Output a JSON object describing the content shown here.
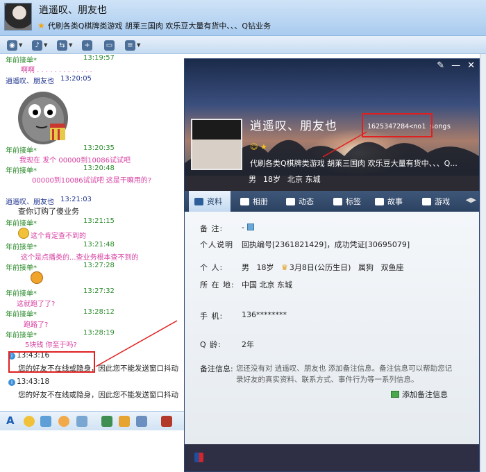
{
  "header": {
    "contact_name": "逍遥叹、朋友也",
    "signature": "代刷各类Q棋牌类游戏   胡莱三国肉   欢乐豆大量有货中、、、Q钻业务"
  },
  "chat": {
    "messages": [
      {
        "sender": "年前接单*",
        "time": "13:19:57",
        "text": "啊啊 . . . . . . . . . . . . ."
      },
      {
        "sender": "逍遥叹、朋友也",
        "time": "13:20:05"
      },
      {
        "sender": "年前接单*",
        "time": "13:20:35",
        "text": "我现在 发个 00000到10086试试吧"
      },
      {
        "sender": "年前接单*",
        "time": "13:20:48",
        "text": "00000到10086试试吧    这是干嘛用的?"
      },
      {
        "sender": "逍遥叹、朋友也",
        "time": "13:21:03",
        "text": "查你订购了傻业务"
      },
      {
        "sender": "年前接单*",
        "time": "13:21:15",
        "text": "这个肯定查不到的"
      },
      {
        "sender": "年前接单*",
        "time": "13:21:48",
        "text": "这个是点播类的...查业务根本查不到的"
      },
      {
        "sender": "年前接单*",
        "time": "13:27:28"
      },
      {
        "sender": "年前接单*",
        "time": "13:27:32",
        "text": "这就跑了了?"
      },
      {
        "sender": "年前接单*",
        "time": "13:28:12",
        "text": "跑路了?"
      },
      {
        "sender": "年前接单*",
        "time": "13:28:19",
        "text": "5块钱 你至于吗?"
      }
    ],
    "system": [
      {
        "time": "13:43:16",
        "text": "您的好友不在线或隐身，因此您不能发送窗口抖动"
      },
      {
        "time": "13:43:18",
        "text": "您的好友不在线或隐身，因此您不能发送窗口抖动"
      }
    ]
  },
  "profile": {
    "name": "逍遥叹、朋友也",
    "qq_song": "1625347284<no1 songs",
    "signature": "代刷各类Q棋牌类游戏   胡莱三国肉   欢乐豆大量有货中、、、Q...",
    "basic": {
      "gender": "男",
      "age": "18岁",
      "location": "北京 东城"
    },
    "tabs": [
      "资料",
      "相册",
      "动态",
      "标签",
      "故事",
      "游戏"
    ],
    "fields": {
      "remark_label": "备    注:",
      "remark_value": "-",
      "desc_label": "个人说明",
      "desc_value": "回执编号[2361821429]，成功凭证[30695079]",
      "personal_label": "个    人:",
      "gender": "男",
      "age": "18岁",
      "birthday": "3月8日(公历生日)",
      "zodiac": "属狗",
      "constellation": "双鱼座",
      "location_label": "所 在 地:",
      "location_value": "中国 北京 东城",
      "phone_label": "手    机:",
      "phone_value": "136********",
      "qage_label": "Q     龄:",
      "qage_value": "2年",
      "note_label": "备注信息:",
      "note_text": "您还没有对 逍遥叹、朋友也 添加备注信息。备注信息可以帮助您记录好友的真实资料、联系方式、事件行为等一系列信息。",
      "add_note": "添加备注信息"
    }
  },
  "colors": {
    "sender": "#2b8a2b",
    "me": "#1a2f8c",
    "pink_text": "#d63ea0",
    "highlight": "#e02020"
  }
}
